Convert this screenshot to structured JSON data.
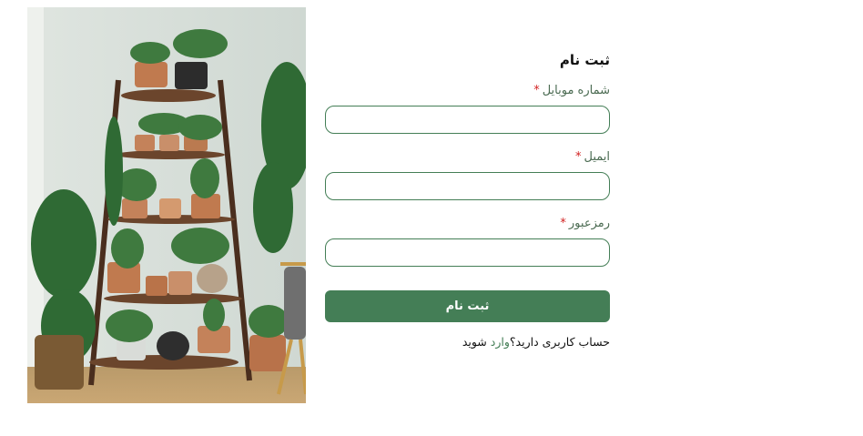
{
  "image": {
    "alt_icon": "plants-on-ladder-shelf"
  },
  "form": {
    "title": "ثبت نام",
    "required_mark": "*",
    "fields": [
      {
        "label": "شماره موبایل",
        "value": "",
        "placeholder": ""
      },
      {
        "label": "ایمیل",
        "value": "",
        "placeholder": ""
      },
      {
        "label": "رمزعبور",
        "value": "",
        "placeholder": ""
      }
    ],
    "submit_label": "ثبت نام",
    "login_prompt": "حساب کاربری دارید؟",
    "login_link": "وارد",
    "login_suffix": " شوید"
  },
  "colors": {
    "accent": "#447e56",
    "required": "#d11f1f",
    "label": "#4b6b52"
  }
}
